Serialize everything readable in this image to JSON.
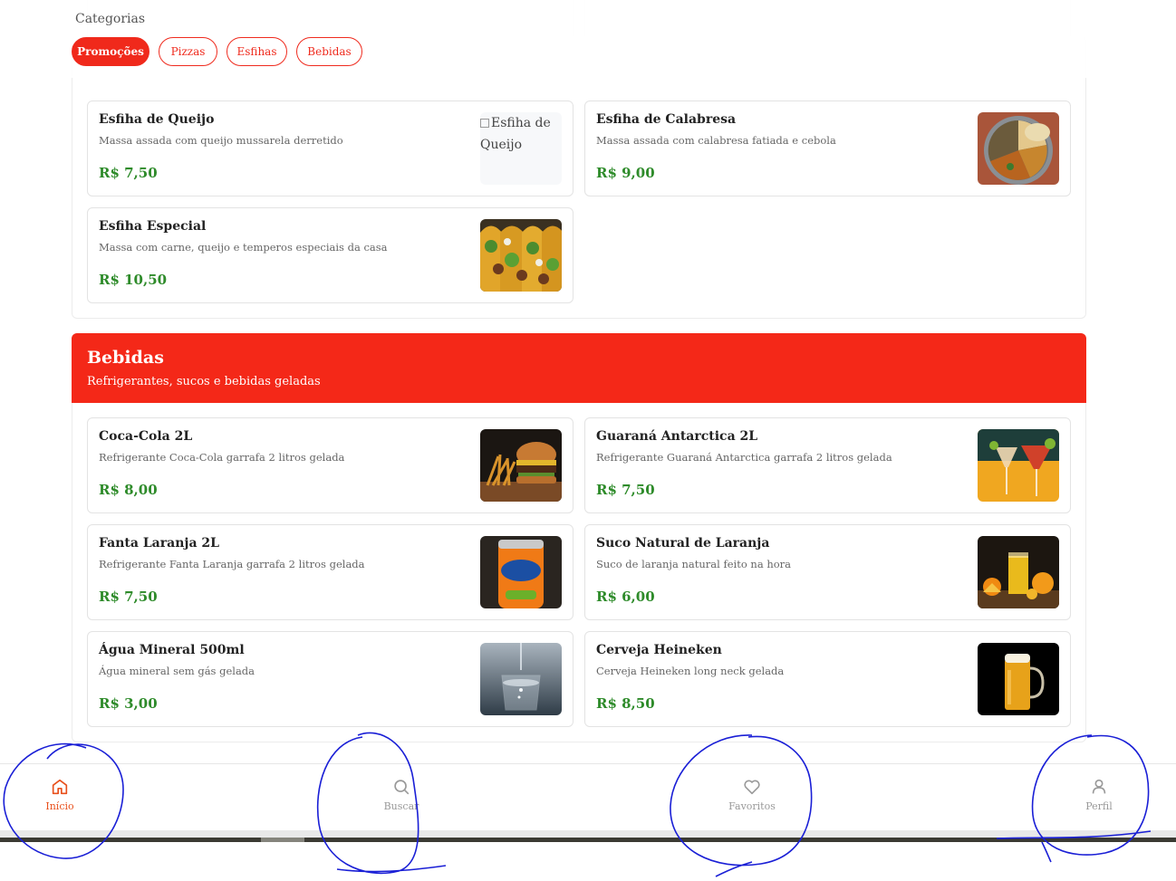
{
  "header": {
    "title": "Categorias",
    "pills": [
      {
        "label": "Promoções",
        "active": true
      },
      {
        "label": "Pizzas",
        "active": false
      },
      {
        "label": "Esfihas",
        "active": false
      },
      {
        "label": "Bebidas",
        "active": false
      }
    ]
  },
  "esfihas": {
    "items": [
      {
        "name": "Esfiha de Queijo",
        "desc": "Massa assada com queijo mussarela derretido",
        "price": "R$ 7,50",
        "img_alt": "Esfiha de Queijo",
        "img": "broken"
      },
      {
        "name": "Esfiha de Calabresa",
        "desc": "Massa assada com calabresa fatiada e cebola",
        "price": "R$ 9,00",
        "img": "food-platter"
      },
      {
        "name": "Esfiha Especial",
        "desc": "Massa com carne, queijo e temperos especiais da casa",
        "price": "R$ 10,50",
        "img": "tacos"
      }
    ]
  },
  "bebidas": {
    "title": "Bebidas",
    "subtitle": "Refrigerantes, sucos e bebidas geladas",
    "items": [
      {
        "name": "Coca-Cola 2L",
        "desc": "Refrigerante Coca-Cola garrafa 2 litros gelada",
        "price": "R$ 8,00",
        "img": "burger-fries"
      },
      {
        "name": "Guaraná Antarctica 2L",
        "desc": "Refrigerante Guaraná Antarctica garrafa 2 litros gelada",
        "price": "R$ 7,50",
        "img": "cocktails"
      },
      {
        "name": "Fanta Laranja 2L",
        "desc": "Refrigerante Fanta Laranja garrafa 2 litros gelada",
        "price": "R$ 7,50",
        "img": "fanta-can"
      },
      {
        "name": "Suco Natural de Laranja",
        "desc": "Suco de laranja natural feito na hora",
        "price": "R$ 6,00",
        "img": "orange-juice"
      },
      {
        "name": "Água Mineral 500ml",
        "desc": "Água mineral sem gás gelada",
        "price": "R$ 3,00",
        "img": "water-glass"
      },
      {
        "name": "Cerveja Heineken",
        "desc": "Cerveja Heineken long neck gelada",
        "price": "R$ 8,50",
        "img": "beer-mug"
      }
    ]
  },
  "nav": {
    "items": [
      {
        "label": "Início",
        "icon": "home-icon",
        "active": true
      },
      {
        "label": "Buscar",
        "icon": "search-icon",
        "active": false
      },
      {
        "label": "Favoritos",
        "icon": "heart-icon",
        "active": false
      },
      {
        "label": "Perfil",
        "icon": "user-icon",
        "active": false
      }
    ]
  },
  "colors": {
    "accent": "#f42818",
    "price": "#2e8b2a",
    "nav_active": "#e8501c",
    "annotation": "#1a1fd6"
  }
}
